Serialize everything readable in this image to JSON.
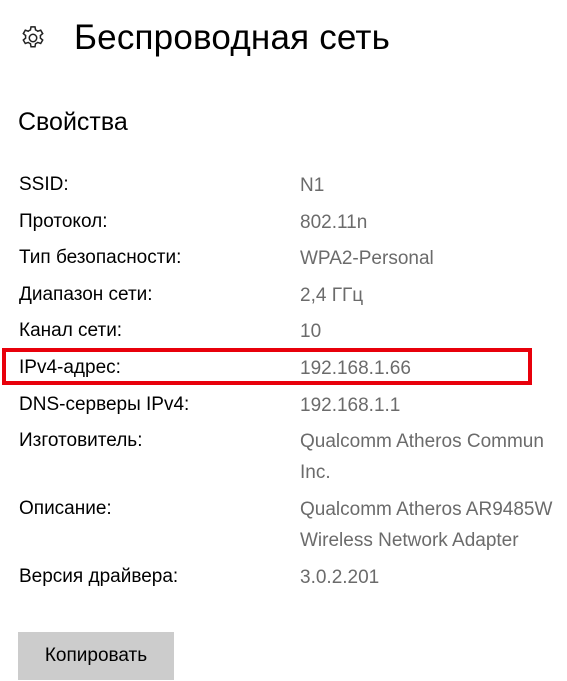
{
  "header": {
    "icon": "gear-icon",
    "title": "Беспроводная сеть"
  },
  "section": {
    "title": "Свойства"
  },
  "properties": [
    {
      "label": "SSID:",
      "lines": [
        "N1"
      ]
    },
    {
      "label": "Протокол:",
      "lines": [
        "802.11n"
      ]
    },
    {
      "label": "Тип безопасности:",
      "lines": [
        "WPA2-Personal"
      ]
    },
    {
      "label": "Диапазон сети:",
      "lines": [
        "2,4 ГГц"
      ]
    },
    {
      "label": "Канал сети:",
      "lines": [
        "10"
      ]
    },
    {
      "label": "IPv4-адрес:",
      "lines": [
        "192.168.1.66"
      ]
    },
    {
      "label": "DNS-серверы IPv4:",
      "lines": [
        "192.168.1.1"
      ]
    },
    {
      "label": "Изготовитель:",
      "lines": [
        "Qualcomm Atheros Commun",
        "Inc."
      ]
    },
    {
      "label": "Описание:",
      "lines": [
        "Qualcomm Atheros AR9485W",
        "Wireless Network Adapter"
      ]
    },
    {
      "label": "Версия драйвера:",
      "lines": [
        "3.0.2.201"
      ]
    }
  ],
  "highlight": {
    "color": "#e8000b",
    "target": "IPv4-адрес"
  },
  "actions": {
    "copy_label": "Копировать"
  }
}
